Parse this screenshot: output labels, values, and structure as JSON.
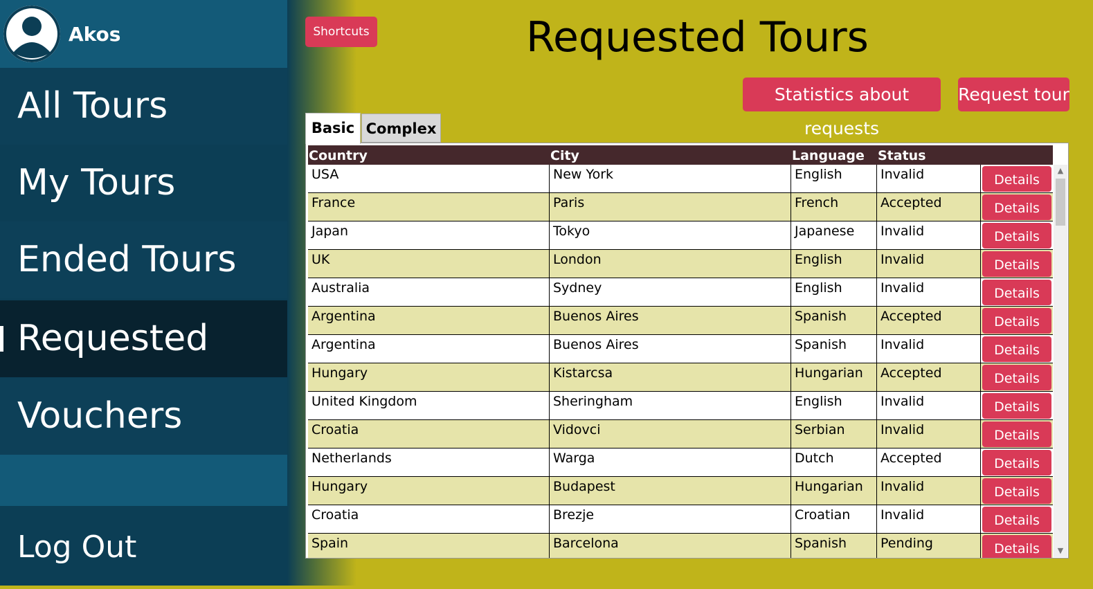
{
  "sidebar": {
    "username": "Akos",
    "items": [
      {
        "label": "All Tours"
      },
      {
        "label": "My Tours"
      },
      {
        "label": "Ended Tours"
      },
      {
        "label": "Requested Tours"
      },
      {
        "label": "Vouchers"
      }
    ],
    "logout_label": "Log Out"
  },
  "header": {
    "shortcuts_label": "Shortcuts",
    "title": "Requested Tours",
    "statistics_label": "Statistics about requests",
    "request_label": "Request tour"
  },
  "tabs": [
    {
      "label": "Basic"
    },
    {
      "label": "Complex"
    }
  ],
  "table": {
    "columns": [
      "Country",
      "City",
      "Language",
      "Status"
    ],
    "details_label": "Details",
    "rows": [
      {
        "country": "USA",
        "city": "New York",
        "language": "English",
        "status": "Invalid"
      },
      {
        "country": "France",
        "city": "Paris",
        "language": "French",
        "status": "Accepted"
      },
      {
        "country": "Japan",
        "city": "Tokyo",
        "language": "Japanese",
        "status": "Invalid"
      },
      {
        "country": "UK",
        "city": "London",
        "language": "English",
        "status": "Invalid"
      },
      {
        "country": "Australia",
        "city": "Sydney",
        "language": "English",
        "status": "Invalid"
      },
      {
        "country": "Argentina",
        "city": "Buenos Aires",
        "language": "Spanish",
        "status": "Accepted"
      },
      {
        "country": "Argentina",
        "city": "Buenos Aires",
        "language": "Spanish",
        "status": "Invalid"
      },
      {
        "country": "Hungary",
        "city": "Kistarcsa",
        "language": "Hungarian",
        "status": "Accepted"
      },
      {
        "country": "United Kingdom",
        "city": "Sheringham",
        "language": "English",
        "status": "Invalid"
      },
      {
        "country": "Croatia",
        "city": "Vidovci",
        "language": "Serbian",
        "status": "Invalid"
      },
      {
        "country": "Netherlands",
        "city": "Warga",
        "language": "Dutch",
        "status": "Accepted"
      },
      {
        "country": "Hungary",
        "city": "Budapest",
        "language": "Hungarian",
        "status": "Invalid"
      },
      {
        "country": "Croatia",
        "city": "Brezje",
        "language": "Croatian",
        "status": "Invalid"
      },
      {
        "country": "Spain",
        "city": "Barcelona",
        "language": "Spanish",
        "status": "Pending"
      }
    ]
  },
  "colors": {
    "sidebar_bg": "#0c3e55",
    "sidebar_active": "#08222f",
    "main_bg": "#c0b41a",
    "accent_red": "#d93a57",
    "table_header": "#45282c",
    "row_alt": "#e6e4aa"
  }
}
